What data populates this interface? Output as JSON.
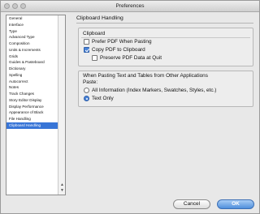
{
  "window": {
    "title": "Preferences"
  },
  "sidebar": {
    "items": [
      "General",
      "Interface",
      "Type",
      "Advanced Type",
      "Composition",
      "Units & Increments",
      "Grids",
      "Guides & Pasteboard",
      "Dictionary",
      "Spelling",
      "Autocorrect",
      "Notes",
      "Track Changes",
      "Story Editor Display",
      "Display Performance",
      "Appearance of Black",
      "File Handling",
      "Clipboard Handling"
    ],
    "selected": "Clipboard Handling"
  },
  "panel": {
    "title": "Clipboard Handling",
    "clipboard_group": {
      "label": "Clipboard",
      "prefer_pdf": {
        "label": "Prefer PDF When Pasting",
        "checked": false
      },
      "copy_pdf": {
        "label": "Copy PDF to Clipboard",
        "checked": true
      },
      "preserve_pdf": {
        "label": "Preserve PDF Data at Quit",
        "checked": false
      }
    },
    "paste_group": {
      "label": "When Pasting Text and Tables from Other Applications",
      "paste_label": "Paste:",
      "all_info": {
        "label": "All Information (Index Markers, Swatches, Styles, etc.)",
        "selected": false
      },
      "text_only": {
        "label": "Text Only",
        "selected": true
      }
    }
  },
  "buttons": {
    "cancel": "Cancel",
    "ok": "OK"
  }
}
